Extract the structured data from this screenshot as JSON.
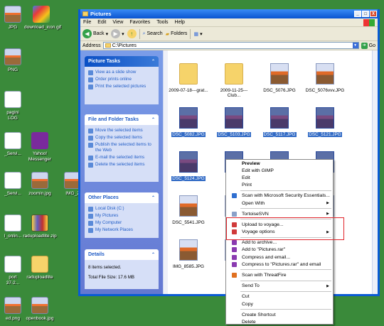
{
  "desktop": [
    {
      "label": "JPG"
    },
    {
      "label": "download_icon.gif"
    },
    {
      "label": "PNG"
    },
    {
      "label": "pagini\nLOG"
    },
    {
      "label": "_Servi..."
    },
    {
      "label": "Yahoo!\nMessenger"
    },
    {
      "label": "_Servi..."
    },
    {
      "label": "zoomin.jpg"
    },
    {
      "label": "IMG_2"
    },
    {
      "label": "l_onlin..."
    },
    {
      "label": "raduploadlite.zip"
    },
    {
      "label": "port\n37-2..."
    },
    {
      "label": "raduploadlite"
    },
    {
      "label": "ed.png"
    },
    {
      "label": "openbook.jpg"
    }
  ],
  "window": {
    "title": "Pictures",
    "min": "_",
    "max": "□",
    "close": "X"
  },
  "menu": [
    "File",
    "Edit",
    "View",
    "Favorites",
    "Tools",
    "Help"
  ],
  "toolbar": {
    "back": "Back",
    "search": "Search",
    "folders": "Folders"
  },
  "address": {
    "label": "Address",
    "value": "C:\\Pictures",
    "go": "Go"
  },
  "tasks": {
    "picture": {
      "title": "Picture Tasks",
      "items": [
        "View as a slide show",
        "Order prints online",
        "Print the selected pictures"
      ]
    },
    "file": {
      "title": "File and Folder Tasks",
      "items": [
        "Move the selected items",
        "Copy the selected items",
        "Publish the selected items to the Web",
        "E-mail the selected items",
        "Delete the selected items"
      ]
    },
    "other": {
      "title": "Other Places",
      "items": [
        "Local Disk (C:)",
        "My Pictures",
        "My Computer",
        "My Network Places"
      ]
    },
    "details": {
      "title": "Details",
      "count": "8 items selected.",
      "size": "Total File Size: 17.6 MB"
    }
  },
  "files": [
    {
      "name": "2009-07-18---grat...",
      "type": "folder",
      "sel": false
    },
    {
      "name": "2009-11-25---Club...",
      "type": "folder",
      "sel": false
    },
    {
      "name": "DSC_5076.JPG",
      "type": "jpg",
      "sel": false
    },
    {
      "name": "DSC_5076vvv.JPG",
      "type": "jpg",
      "sel": false
    },
    {
      "name": "DSC_5082.JPG",
      "type": "jpg",
      "sel": true
    },
    {
      "name": "DSC_5103.JPG",
      "type": "jpg",
      "sel": true
    },
    {
      "name": "DSC_5117.JPG",
      "type": "jpg",
      "sel": true
    },
    {
      "name": "DSC_5121.JPG",
      "type": "jpg",
      "sel": true
    },
    {
      "name": "DSC_5124.JPG",
      "type": "jpg",
      "sel": true
    },
    {
      "name": "DSC_5",
      "type": "jpg",
      "sel": true
    },
    {
      "name": "",
      "type": "jpg",
      "sel": true
    },
    {
      "name": "JPG",
      "type": "jpg",
      "sel": true
    },
    {
      "name": "DSC_5541.JPG",
      "type": "jpg",
      "sel": false
    },
    {
      "name": "DSC_5",
      "type": "jpg",
      "sel": false
    },
    {
      "name": "",
      "type": "jpg",
      "sel": false
    },
    {
      "name": ".jpg",
      "type": "jpg",
      "sel": false
    },
    {
      "name": "IMG_8585.JPG",
      "type": "jpg",
      "sel": false
    },
    {
      "name": "IMG_8",
      "type": "jpg",
      "sel": false
    }
  ],
  "context": {
    "items": [
      {
        "label": "Preview",
        "bold": true
      },
      {
        "label": "Edit with GIMP"
      },
      {
        "label": "Edit"
      },
      {
        "label": "Print"
      },
      {
        "sep": true
      },
      {
        "label": "Scan with Microsoft Security Essentials...",
        "icon": "#2f6fd0"
      },
      {
        "label": "Open With",
        "arrow": true
      },
      {
        "sep": true
      },
      {
        "label": "TortoiseSVN",
        "arrow": true,
        "icon": "#8aa0c8"
      },
      {
        "sep": true
      },
      {
        "label": "Upload to voyage...",
        "icon": "#d03a3a"
      },
      {
        "label": "Voyage options",
        "arrow": true,
        "icon": "#d03a3a"
      },
      {
        "sep": true
      },
      {
        "label": "Add to archive...",
        "icon": "#8a3ab0"
      },
      {
        "label": "Add to \"Pictures.rar\"",
        "icon": "#8a3ab0"
      },
      {
        "label": "Compress and email...",
        "icon": "#8a3ab0"
      },
      {
        "label": "Compress to \"Pictures.rar\" and email",
        "icon": "#8a3ab0"
      },
      {
        "sep": true
      },
      {
        "label": "Scan with ThreatFire",
        "icon": "#e07020"
      },
      {
        "sep": true
      },
      {
        "label": "Send To",
        "arrow": true
      },
      {
        "sep": true
      },
      {
        "label": "Cut"
      },
      {
        "label": "Copy"
      },
      {
        "sep": true
      },
      {
        "label": "Create Shortcut"
      },
      {
        "label": "Delete"
      }
    ]
  }
}
